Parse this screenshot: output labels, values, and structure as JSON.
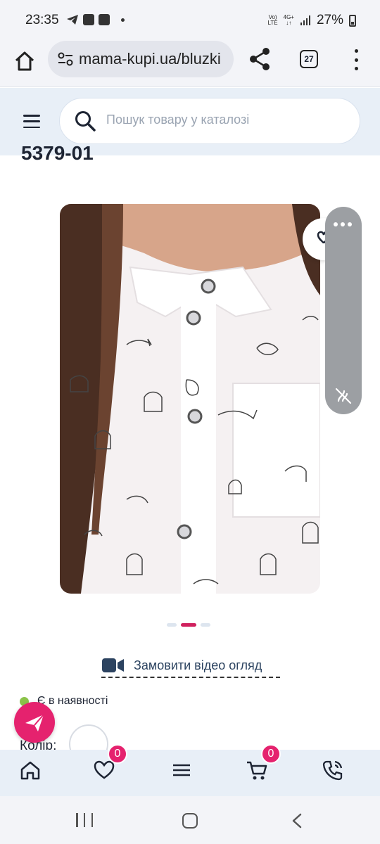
{
  "status_bar": {
    "time": "23:35",
    "net_top": "Vo)",
    "net_bottom": "LTE",
    "gen_top": "4G+",
    "gen_bottom": "↓↑",
    "battery": "27%"
  },
  "browser": {
    "url": "mama-kupi.ua/bluzki",
    "tab_count": "27"
  },
  "header": {
    "search_placeholder": "Пошук товару у каталозі"
  },
  "product": {
    "sku": "5379-01",
    "video_label": "Замовити відео огляд",
    "stock_label": "Є в наявності",
    "color_label": "Колір:"
  },
  "carousel": {
    "count": 3,
    "active_index": 1
  },
  "bottom_nav": {
    "favorites_badge": "0",
    "cart_badge": "0"
  },
  "colors": {
    "accent": "#e5226e",
    "header_bg": "#e8eff7",
    "stock_green": "#8bc34a"
  },
  "icons": [
    "home-icon",
    "share-icon",
    "tabs-icon",
    "search-icon",
    "heart-icon",
    "video-camera-icon",
    "menu-icon",
    "cart-icon",
    "phone-icon"
  ]
}
